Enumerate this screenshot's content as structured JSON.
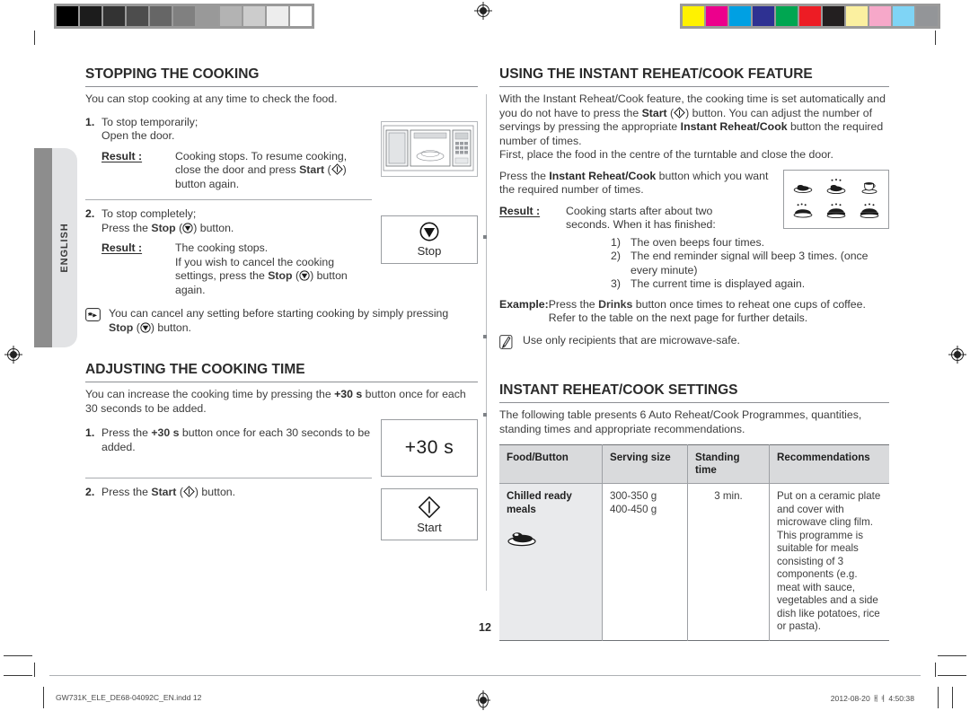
{
  "document": {
    "language_tab": "ENGLISH",
    "page_number": "12"
  },
  "calibration": {
    "gray_bar_name": "grayscale-calibration-bar",
    "gray_swatches": [
      "#000000",
      "#1c1c1c",
      "#333333",
      "#4d4d4d",
      "#666666",
      "#808080",
      "#999999",
      "#b3b3b3",
      "#cccccc",
      "#ededed",
      "#ffffff"
    ],
    "color_bar_name": "color-calibration-bar",
    "color_swatches": [
      "#fff200",
      "#ec008c",
      "#00a0e3",
      "#2e3192",
      "#00a651",
      "#ed1c24",
      "#231f20",
      "#fbf0a0",
      "#f6a8c9",
      "#7fd4f5",
      "#939598"
    ]
  },
  "left_column": {
    "section1": {
      "heading": "Stopping the cooking",
      "intro": "You can stop cooking at any time to check the food.",
      "step1": {
        "number": "1.",
        "line1": "To stop temporarily;",
        "line2": "Open the door.",
        "result_label": "Result :",
        "result_line1": "Cooking stops. To resume cooking,",
        "result_line2_pre": "close the door and press ",
        "result_line2_bold": "Start",
        "result_line2_post": " (",
        "result_line2_end": ") ",
        "result_line3": "button again."
      },
      "step2": {
        "number": "2.",
        "line1": "To stop completely;",
        "line2_pre": "Press the ",
        "line2_bold": "Stop",
        "line2_post": " (",
        "line2_end": ") button.",
        "result_label": "Result :",
        "result_line1": "The cooking stops.",
        "result_line2": "If you wish to cancel the cooking",
        "result_line3_pre": "settings, press the ",
        "result_line3_bold": "Stop",
        "result_line3_post": " (",
        "result_line3_end": ") button again."
      },
      "note": {
        "line1": "You can cancel any setting before starting cooking by simply pressing",
        "line2_bold": "Stop",
        "line2_post": " (",
        "line2_end": ") button."
      },
      "stop_button_box": {
        "label": "Stop",
        "icon": "stop-symbol-icon"
      },
      "oven_illustration": "microwave-oven-open-door-illustration"
    },
    "section2": {
      "heading": "Adjusting the cooking time",
      "intro_pre": "You can increase the cooking time by pressing the ",
      "intro_bold": "+30 s",
      "intro_post": " button once for each 30 seconds to be added.",
      "step1": {
        "number": "1.",
        "text_pre": "Press the ",
        "text_bold": "+30 s",
        "text_post": " button once for each 30 seconds to be added."
      },
      "step2": {
        "number": "2.",
        "text_pre": "Press the ",
        "text_bold": "Start",
        "text_post": " (",
        "text_end": ") button."
      },
      "plus30_button_box": {
        "label": "+30 s"
      },
      "start_button_box": {
        "label": "Start",
        "icon": "start-diamond-icon"
      }
    }
  },
  "right_column": {
    "section1": {
      "heading": "Using the instant reheat/cook feature",
      "para1_a": "With the Instant Reheat/Cook feature, the cooking time is set automatically and you do not have to press the ",
      "para1_bold1": "Start",
      "para1_b": " (",
      "para1_c": ") button. You can adjust the number of servings by pressing the appropriate ",
      "para1_bold2": "Instant Reheat/Cook",
      "para1_d": " button the required number of times.",
      "para2": "First, place the food in the centre of the turntable and close the door.",
      "para3_pre": "Press the ",
      "para3_bold": "Instant Reheat/Cook",
      "para3_post": " button which you want the required number of times.",
      "result_label": "Result :",
      "result_intro_line1": "Cooking starts after about two",
      "result_intro_line2": "seconds. When it has finished:",
      "result_items": [
        {
          "marker": "1)",
          "text": "The oven beeps four times."
        },
        {
          "marker": "2)",
          "text": "The end reminder signal will beep 3 times. (once every minute)"
        },
        {
          "marker": "3)",
          "text": "The current time is displayed again."
        }
      ],
      "example_label": "Example:",
      "example_pre": "Press the ",
      "example_bold": "Drinks",
      "example_post": " button once times to reheat one cups of coffee. Refer to the table on the next page for further details.",
      "note": "Use only recipients that are microwave-safe.",
      "icon_panel_name": "instant-reheat-cook-button-icons"
    },
    "section2": {
      "heading": "Instant reheat/cook settings",
      "intro": "The following table presents 6 Auto Reheat/Cook Programmes, quantities, standing times and appropriate recommendations.",
      "table": {
        "columns": [
          "Food/Button",
          "Serving size",
          "Standing time",
          "Recommendations"
        ],
        "rows": [
          {
            "food": "Chilled ready meals",
            "food_icon": "chilled-ready-meal-plate-icon",
            "serving_size": "300-350 g\n400-450 g",
            "standing_time": "3 min.",
            "recommendations": "Put on a ceramic plate and cover with microwave cling film. This programme is suitable for meals consisting of 3 components (e.g. meat with sauce, vegetables and a side dish like potatoes, rice or pasta)."
          }
        ]
      }
    }
  },
  "footer": {
    "file_name": "GW731K_ELE_DE68-04092C_EN.indd   12",
    "timestamp": "2012-08-20   ㅐㅕ 4:50:38"
  }
}
